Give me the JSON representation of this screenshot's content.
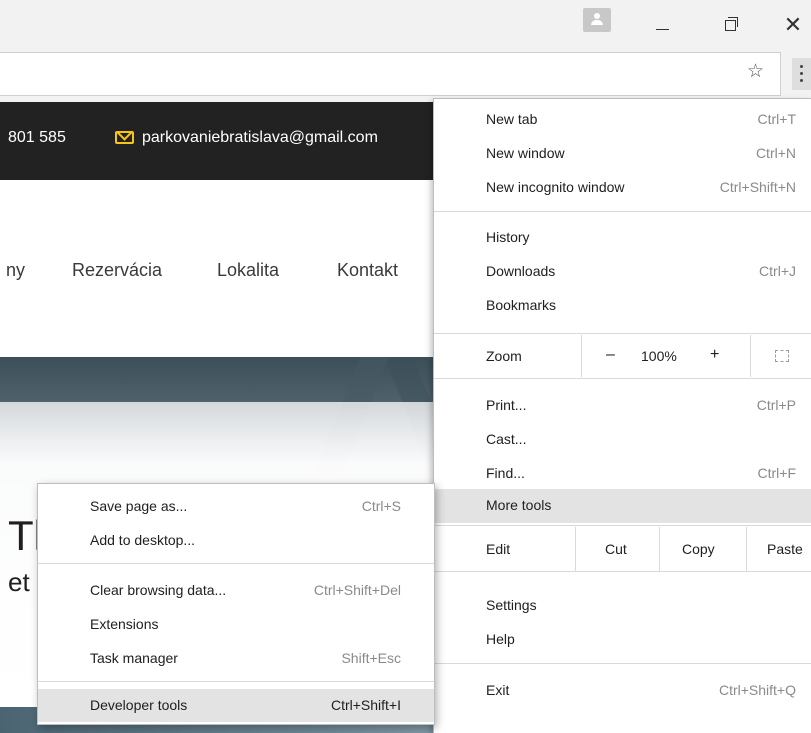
{
  "site": {
    "phone": "801 585",
    "email": "parkovaniebratislava@gmail.com",
    "nav": [
      "ny",
      "Rezervácia",
      "Lokalita",
      "Kontakt"
    ],
    "heading_large": "Tl",
    "heading_small": "et"
  },
  "menu": {
    "new_tab": {
      "label": "New tab",
      "shortcut": "Ctrl+T"
    },
    "new_window": {
      "label": "New window",
      "shortcut": "Ctrl+N"
    },
    "new_incognito": {
      "label": "New incognito window",
      "shortcut": "Ctrl+Shift+N"
    },
    "history": {
      "label": "History"
    },
    "downloads": {
      "label": "Downloads",
      "shortcut": "Ctrl+J"
    },
    "bookmarks": {
      "label": "Bookmarks"
    },
    "zoom": {
      "label": "Zoom",
      "minus": "–",
      "level": "100%",
      "plus": "+"
    },
    "print": {
      "label": "Print...",
      "shortcut": "Ctrl+P"
    },
    "cast": {
      "label": "Cast..."
    },
    "find": {
      "label": "Find...",
      "shortcut": "Ctrl+F"
    },
    "more_tools": {
      "label": "More tools"
    },
    "edit": {
      "label": "Edit",
      "cut": "Cut",
      "copy": "Copy",
      "paste": "Paste"
    },
    "settings": {
      "label": "Settings"
    },
    "help": {
      "label": "Help"
    },
    "exit": {
      "label": "Exit",
      "shortcut": "Ctrl+Shift+Q"
    }
  },
  "submenu": {
    "save_page": {
      "label": "Save page as...",
      "shortcut": "Ctrl+S"
    },
    "add_desktop": {
      "label": "Add to desktop..."
    },
    "clear_data": {
      "label": "Clear browsing data...",
      "shortcut": "Ctrl+Shift+Del"
    },
    "extensions": {
      "label": "Extensions"
    },
    "task_manager": {
      "label": "Task manager",
      "shortcut": "Shift+Esc"
    },
    "dev_tools": {
      "label": "Developer tools",
      "shortcut": "Ctrl+Shift+I"
    }
  },
  "window": {
    "close_glyph": "✕",
    "star_glyph": "☆"
  },
  "colors": {
    "accent": "#f5c518",
    "topbar": "#222222",
    "highlight": "#e3e3e3"
  }
}
